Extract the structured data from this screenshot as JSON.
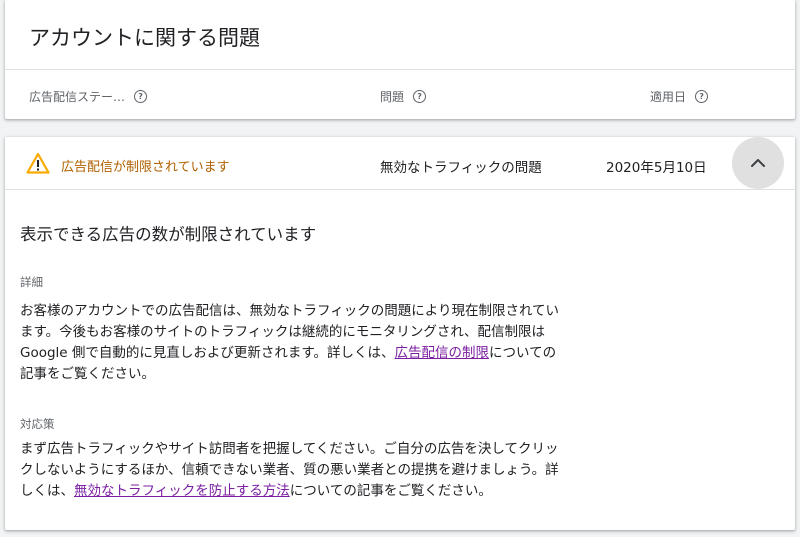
{
  "account_issues": {
    "title": "アカウントに関する問題",
    "columns": [
      {
        "label": "広告配信ステー…",
        "help_icon": "?"
      },
      {
        "label": "問題",
        "help_icon": "?"
      },
      {
        "label": "適用日",
        "help_icon": "?"
      }
    ]
  },
  "issue": {
    "status": "広告配信が制限されています",
    "status_color": "#b06000",
    "warning_icon_color": "#f9ab00",
    "problem": "無効なトラフィックの問題",
    "date": "2020年5月10日",
    "collapse_icon": "chevron-up-icon"
  },
  "details": {
    "heading": "表示できる広告の数が制限されています",
    "detail_label": "詳細",
    "detail_lines": {
      "l1": "お客様のアカウントでの広告配信は、無効なトラフィックの問題により現在制限されてい",
      "l2": "ます。今後もお客様のサイトのトラフィックは継続的にモニタリングされ、配信制限は",
      "l3_before": "Google 側で自動的に見直しおよび更新されます。詳しくは、",
      "l3_link": "広告配信の制限",
      "l3_after": "についての",
      "l4": "記事をご覧ください。"
    },
    "action_label": "対応策",
    "action_lines": {
      "l1": "まず広告トラフィックやサイト訪問者を把握してください。ご自分の広告を決してクリッ",
      "l2": "クしないようにするほか、信頼できない業者、質の悪い業者との提携を避けましょう。詳",
      "l3_before": "しくは、",
      "l3_link": "無効なトラフィックを防止する方法",
      "l3_after": "についての記事をご覧ください。"
    },
    "link_color": "#7b1fa2"
  }
}
